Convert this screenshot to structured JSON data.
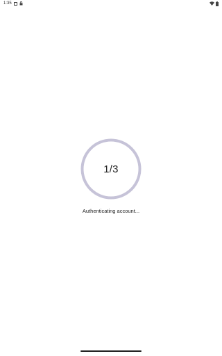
{
  "status_bar": {
    "time": "1:35",
    "icons": [
      "notification-square-icon",
      "lock-icon",
      "wifi-icon",
      "battery-icon"
    ]
  },
  "progress": {
    "step_label": "1/3",
    "current": 1,
    "total": 3,
    "ring_color": "#c6c3d8"
  },
  "message": "Authenticating account..."
}
